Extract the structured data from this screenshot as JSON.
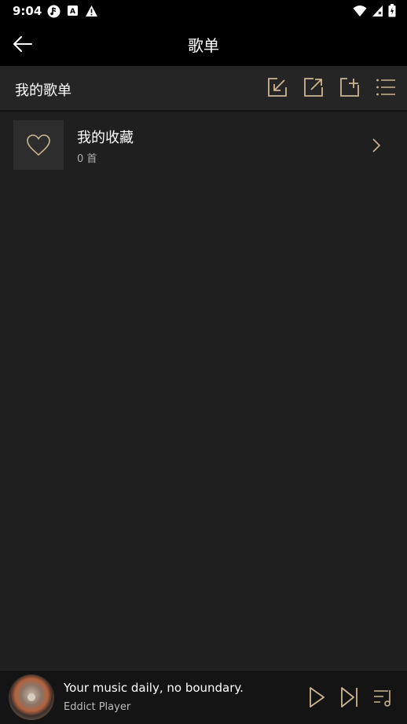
{
  "status_bar": {
    "time": "9:04",
    "left_icons": [
      "music-note-icon",
      "font-download-icon",
      "warning-icon"
    ],
    "right_icons": [
      "wifi-icon",
      "cellular-signal-icon",
      "battery-icon"
    ]
  },
  "toolbar": {
    "title": "歌单",
    "back_icon": "arrow-left-icon"
  },
  "section": {
    "title": "我的歌单",
    "actions": [
      "import-icon",
      "export-icon",
      "add-playlist-icon",
      "menu-list-icon"
    ]
  },
  "playlists": [
    {
      "name": "我的收藏",
      "count": "0 首",
      "icon": "heart-icon"
    }
  ],
  "player": {
    "title": "Your music daily, no boundary.",
    "artist": "Eddict Player",
    "controls": [
      "play-icon",
      "skip-next-icon",
      "queue-icon"
    ]
  },
  "colors": {
    "background": "#1f1f1f",
    "header": "#000000",
    "section_header": "#252525",
    "accent_gold": "#cdb591",
    "player_bar": "#141414"
  }
}
